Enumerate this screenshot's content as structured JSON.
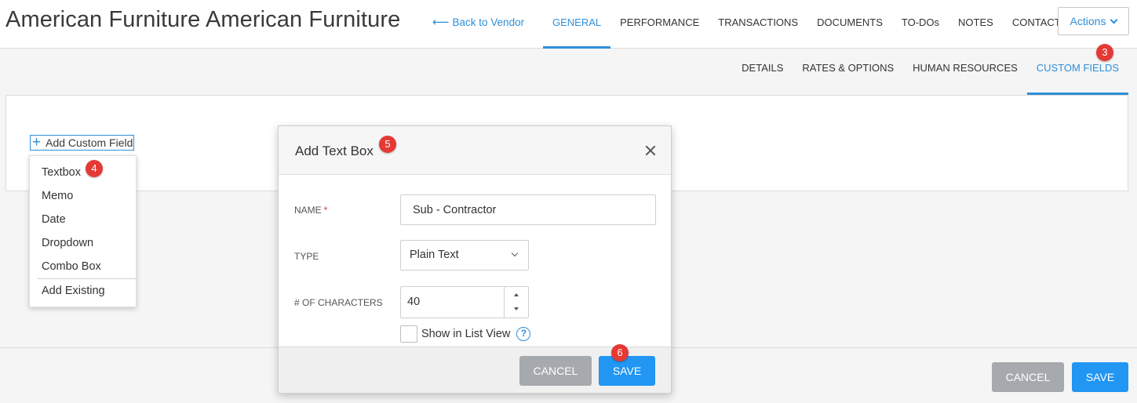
{
  "header": {
    "title": "American Furniture American Furniture",
    "back_link": "Back to Vendor",
    "tabs": [
      {
        "label": "GENERAL",
        "active": true
      },
      {
        "label": "PERFORMANCE",
        "active": false
      },
      {
        "label": "TRANSACTIONS",
        "active": false
      },
      {
        "label": "DOCUMENTS",
        "active": false
      },
      {
        "label": "TO-DOs",
        "active": false
      },
      {
        "label": "NOTES",
        "active": false
      },
      {
        "label": "CONTACTS",
        "active": false
      }
    ],
    "actions_label": "Actions"
  },
  "subtabs": [
    {
      "label": "DETAILS",
      "active": false
    },
    {
      "label": "RATES & OPTIONS",
      "active": false
    },
    {
      "label": "HUMAN RESOURCES",
      "active": false
    },
    {
      "label": "CUSTOM FIELDS",
      "active": true
    }
  ],
  "custom_fields": {
    "add_label": "Add Custom Field",
    "menu": [
      "Textbox",
      "Memo",
      "Date",
      "Dropdown",
      "Combo Box"
    ],
    "add_existing": "Add Existing"
  },
  "modal": {
    "title": "Add Text Box",
    "name_label": "NAME",
    "name_required": "*",
    "name_value": "Sub - Contractor",
    "type_label": "TYPE",
    "type_value": "Plain Text",
    "chars_label": "# OF CHARACTERS",
    "chars_value": "40",
    "show_in_list_label": "Show in List View",
    "help_glyph": "?",
    "cancel_label": "CANCEL",
    "save_label": "SAVE"
  },
  "page_footer": {
    "cancel_label": "CANCEL",
    "save_label": "SAVE"
  },
  "badges": {
    "custom_fields": "3",
    "textbox": "4",
    "modal_title": "5",
    "save": "6"
  },
  "colors": {
    "accent": "#2f8fd8",
    "primary_button": "#2196f3",
    "secondary_button": "#a6a9ad",
    "badge": "#e53935"
  }
}
